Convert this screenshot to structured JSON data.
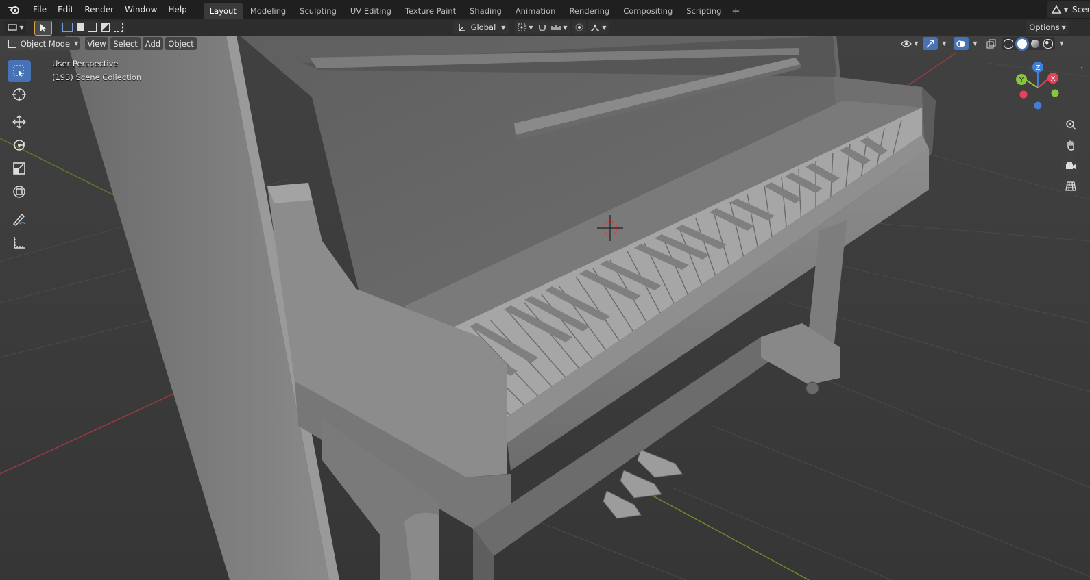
{
  "menu": [
    "File",
    "Edit",
    "Render",
    "Window",
    "Help"
  ],
  "workspaces": [
    {
      "label": "Layout",
      "active": true
    },
    {
      "label": "Modeling",
      "active": false
    },
    {
      "label": "Sculpting",
      "active": false
    },
    {
      "label": "UV Editing",
      "active": false
    },
    {
      "label": "Texture Paint",
      "active": false
    },
    {
      "label": "Shading",
      "active": false
    },
    {
      "label": "Animation",
      "active": false
    },
    {
      "label": "Rendering",
      "active": false
    },
    {
      "label": "Compositing",
      "active": false
    },
    {
      "label": "Scripting",
      "active": false
    }
  ],
  "scene_label": "Scene",
  "toolbar": {
    "orientation": "Global",
    "options_label": "Options"
  },
  "viewport_header": {
    "mode": "Object Mode",
    "menus": [
      "View",
      "Select",
      "Add",
      "Object"
    ]
  },
  "overlay": {
    "perspective": "User Perspective",
    "collection": "(193) Scene Collection"
  },
  "gizmo": {
    "x": "X",
    "y": "Y",
    "z": "Z"
  },
  "colors": {
    "x_axis": "#e7425a",
    "y_axis": "#8bc53f",
    "z_axis": "#3f7fd7",
    "active": "#4772b3"
  }
}
